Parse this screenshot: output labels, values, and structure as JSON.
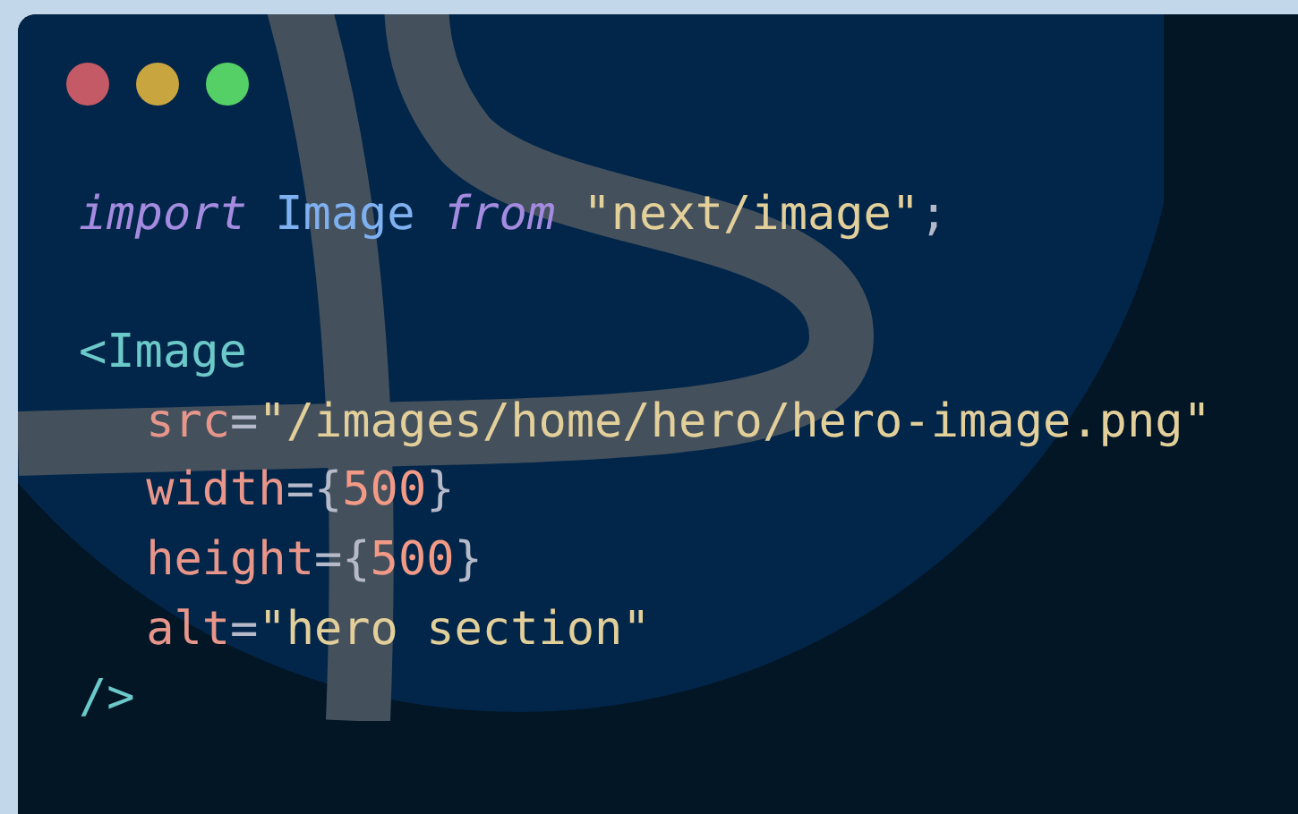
{
  "window": {
    "controls": [
      {
        "color": "#c45a66"
      },
      {
        "color": "#c9a53f"
      },
      {
        "color": "#55d067"
      }
    ]
  },
  "code": {
    "lines": [
      {
        "kind": "code",
        "indented": false,
        "tokens": [
          {
            "kind": "keyword",
            "text": "import"
          },
          {
            "kind": "name",
            "text": "Image",
            "space_before": true
          },
          {
            "kind": "keyword",
            "text": "from",
            "space_before": true
          },
          {
            "kind": "string",
            "text": "\"next/image\"",
            "space_before": true
          },
          {
            "kind": "punct",
            "text": ";"
          }
        ]
      },
      {
        "kind": "blank"
      },
      {
        "kind": "code",
        "indented": false,
        "tokens": [
          {
            "kind": "tag",
            "text": "<Image"
          }
        ]
      },
      {
        "kind": "code",
        "indented": true,
        "tokens": [
          {
            "kind": "attr",
            "text": "src"
          },
          {
            "kind": "punct",
            "text": "="
          },
          {
            "kind": "string",
            "text": "\"/images/home/hero/hero-image.png\""
          }
        ]
      },
      {
        "kind": "code",
        "indented": true,
        "tokens": [
          {
            "kind": "attr",
            "text": "width"
          },
          {
            "kind": "punct",
            "text": "={"
          },
          {
            "kind": "number",
            "text": "500"
          },
          {
            "kind": "punct",
            "text": "}"
          }
        ]
      },
      {
        "kind": "code",
        "indented": true,
        "tokens": [
          {
            "kind": "attr",
            "text": "height"
          },
          {
            "kind": "punct",
            "text": "={"
          },
          {
            "kind": "number",
            "text": "500"
          },
          {
            "kind": "punct",
            "text": "}"
          }
        ]
      },
      {
        "kind": "code",
        "indented": true,
        "tokens": [
          {
            "kind": "attr",
            "text": "alt"
          },
          {
            "kind": "punct",
            "text": "="
          },
          {
            "kind": "string",
            "text": "\"hero section\""
          }
        ]
      },
      {
        "kind": "code",
        "indented": false,
        "tokens": [
          {
            "kind": "tag",
            "text": "/>"
          }
        ]
      }
    ]
  }
}
